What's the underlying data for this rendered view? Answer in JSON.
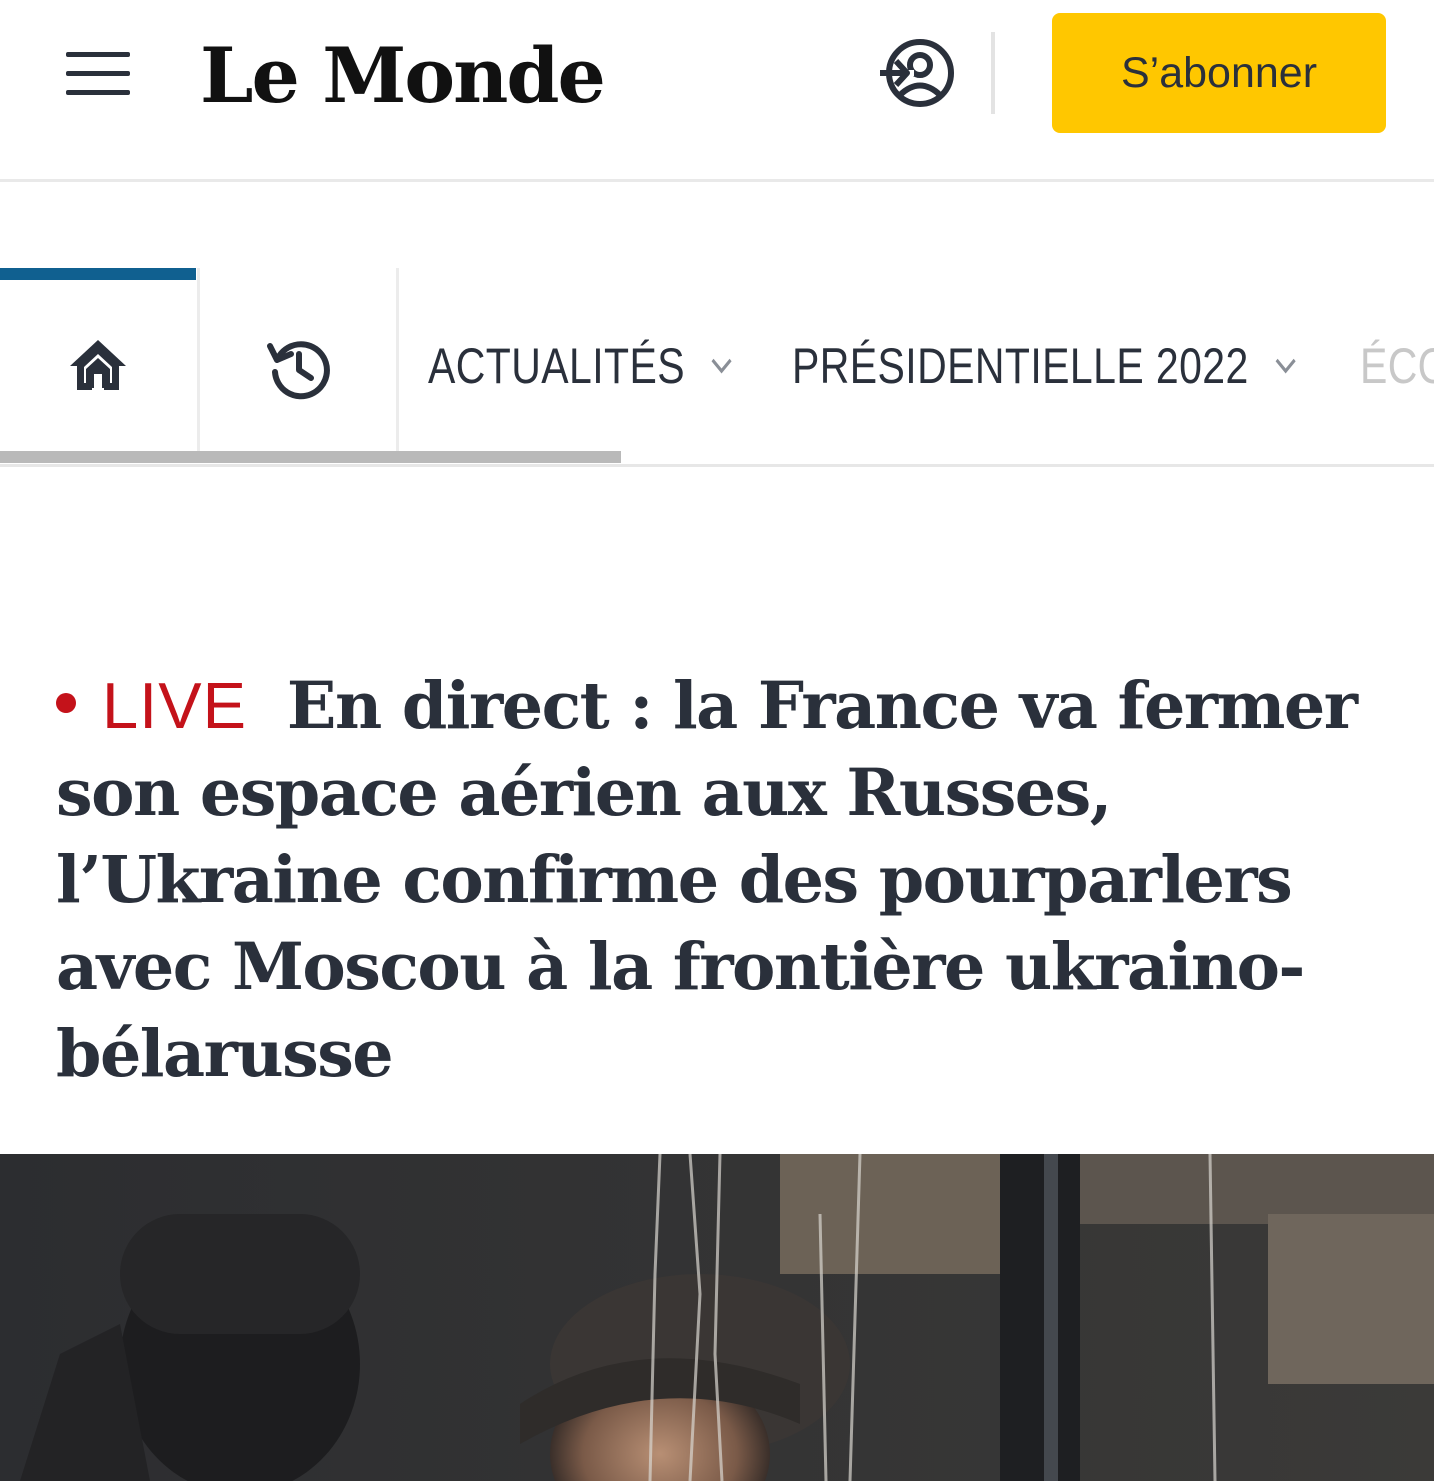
{
  "header": {
    "logo_text": "Le Monde",
    "subscribe_label": "S’abonner",
    "icons": {
      "menu": "hamburger-menu-icon",
      "login": "login-user-icon"
    },
    "colors": {
      "subscribe_bg": "#ffc700",
      "text": "#2a303b"
    }
  },
  "nav": {
    "tabs": [
      {
        "icon": "home-icon",
        "active": true
      },
      {
        "icon": "history-clock-icon",
        "active": false
      }
    ],
    "items": [
      {
        "label": "ACTUALITÉS"
      },
      {
        "label": "PRÉSIDENTIELLE 2022"
      },
      {
        "label": "ÉCO"
      }
    ],
    "colors": {
      "active_bar": "#106090",
      "separator": "#ececec"
    }
  },
  "article": {
    "live_label": "LIVE",
    "headline": "En direct : la France va fermer son espace aérien aux Russes, l’Ukraine confirme des pourparlers avec Moscou à la frontière ukraino-bélarusse",
    "colors": {
      "live": "#c4121a"
    }
  },
  "photo": {
    "description_icon": "news-photo"
  }
}
